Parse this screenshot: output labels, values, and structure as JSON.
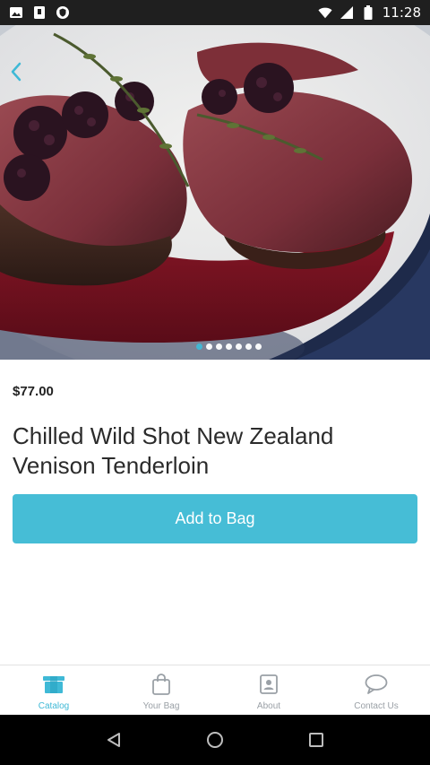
{
  "status_bar": {
    "time": "11:28",
    "icons": [
      "image-icon",
      "sim-icon",
      "shield-icon",
      "wifi-icon",
      "signal-icon",
      "battery-icon"
    ]
  },
  "hero": {
    "image_description_icon": "food-photo",
    "slide_count": 7,
    "active_slide": 1
  },
  "product": {
    "price": "$77.00",
    "title": "Chilled Wild Shot New Zealand Venison Tenderloin",
    "add_to_bag_label": "Add to Bag"
  },
  "tab_bar": {
    "active_color": "#3fb9d6",
    "inactive_color": "#9aa0a6",
    "tabs": [
      {
        "label": "Catalog",
        "icon": "catalog-icon",
        "active": true
      },
      {
        "label": "Your Bag",
        "icon": "bag-icon",
        "active": false
      },
      {
        "label": "About",
        "icon": "about-icon",
        "active": false
      },
      {
        "label": "Contact Us",
        "icon": "chat-icon",
        "active": false
      }
    ]
  },
  "nav_bar": {
    "buttons": [
      "back-nav-icon",
      "home-nav-icon",
      "recents-nav-icon"
    ]
  }
}
